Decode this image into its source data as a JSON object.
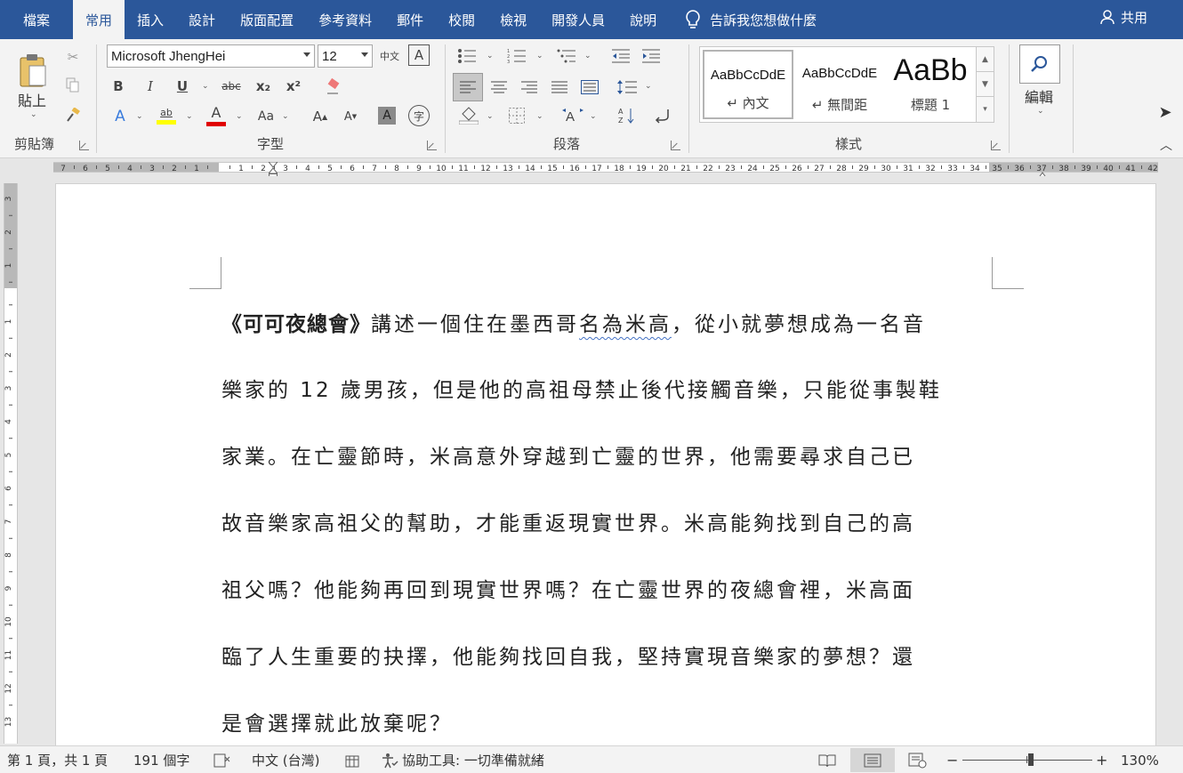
{
  "tabs": [
    "檔案",
    "常用",
    "插入",
    "設計",
    "版面配置",
    "參考資料",
    "郵件",
    "校閱",
    "檢視",
    "開發人員",
    "說明"
  ],
  "active_tab": "常用",
  "tell_me": "告訴我您想做什麼",
  "share": "共用",
  "clipboard": {
    "paste_label": "貼上",
    "group_label": "剪貼簿"
  },
  "font": {
    "name": "Microsoft JhengHei",
    "size": "12",
    "group_label": "字型",
    "bold": "B",
    "italic": "I",
    "underline": "U",
    "strike": "abc",
    "subscript": "x₂",
    "superscript": "x²",
    "font_color_glyph": "A",
    "change_case": "Aa",
    "grow": "A",
    "shrink": "A",
    "shade": "A",
    "phonetic": "字",
    "highlight": "ab",
    "zhuyin": "中文",
    "enclose": "A"
  },
  "paragraph": {
    "group_label": "段落"
  },
  "styles": {
    "group_label": "樣式",
    "items": [
      {
        "sample": "AaBbCcDdE",
        "name": "↵ 內文"
      },
      {
        "sample": "AaBbCcDdE",
        "name": "↵ 無間距"
      },
      {
        "sample": "AaBb",
        "name": "標題 1"
      }
    ]
  },
  "editing": {
    "label": "編輯"
  },
  "ruler": {
    "corner": "L",
    "h_labels_left": [
      "7",
      "6",
      "5",
      "4",
      "3",
      "2",
      "1"
    ],
    "h_labels_right": [
      "1",
      "2",
      "3",
      "4",
      "5",
      "6",
      "7",
      "8",
      "9",
      "10",
      "11",
      "12",
      "13",
      "14",
      "15",
      "16",
      "17",
      "18",
      "19",
      "20",
      "21",
      "22",
      "23",
      "24",
      "25",
      "26",
      "27",
      "28",
      "29",
      "30",
      "31",
      "32",
      "33",
      "34",
      "35",
      "36",
      "37",
      "38",
      "39",
      "40",
      "41",
      "42"
    ],
    "v_labels_top": [
      "3",
      "2",
      "1"
    ],
    "v_labels": [
      "1",
      "2",
      "3",
      "4",
      "5",
      "6",
      "7",
      "8",
      "9",
      "10",
      "11",
      "12",
      "13"
    ]
  },
  "document": {
    "title_bold": "《可可夜總會》",
    "line1_a": "講述一個住在墨西哥",
    "line1_squiggle": "名為米高",
    "line1_b": "，從小就夢想成為一名音",
    "lines": [
      "樂家的 12 歲男孩，但是他的高祖母禁止後代接觸音樂，只能從事製鞋",
      "家業。在亡靈節時，米高意外穿越到亡靈的世界，他需要尋求自己已",
      "故音樂家高祖父的幫助，才能重返現實世界。米高能夠找到自己的高",
      "祖父嗎？他能夠再回到現實世界嗎？在亡靈世界的夜總會裡，米高面",
      "臨了人生重要的抉擇，他能夠找回自我，堅持實現音樂家的夢想？還",
      "是會選擇就此放棄呢？"
    ]
  },
  "status": {
    "page": "第 1 頁，共 1 頁",
    "words": "191 個字",
    "language": "中文 (台灣)",
    "accessibility": "協助工具: 一切準備就緒",
    "zoom_minus": "−",
    "zoom_plus": "+",
    "zoom": "130%"
  },
  "colors": {
    "brand": "#2b579a",
    "highlight": "#ffff00",
    "font_color": "#e00000",
    "squiggle": "#4472c4"
  }
}
